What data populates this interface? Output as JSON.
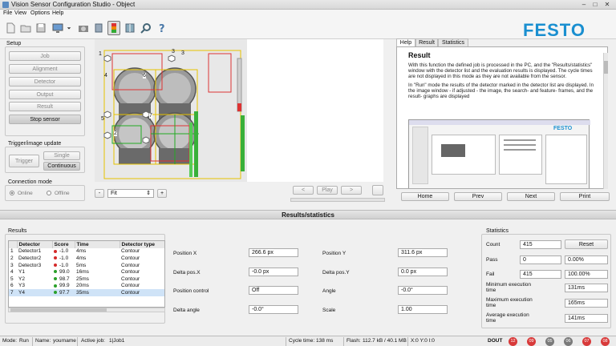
{
  "window": {
    "title": "Vision Sensor Configuration Studio - Object"
  },
  "menu": [
    "File",
    "View",
    "Options",
    "Help"
  ],
  "toolbar_icons": [
    "new-icon",
    "open-icon",
    "save-icon",
    "monitor-icon",
    "camera-icon",
    "film-icon",
    "sensor-icon",
    "run-icon",
    "layout-icon",
    "zoom-icon",
    "help-icon"
  ],
  "brand": "FESTO",
  "setup": {
    "title": "Setup",
    "buttons": [
      "Job",
      "Alignment",
      "Detector",
      "Output",
      "Result",
      "Stop sensor"
    ]
  },
  "trigger": {
    "title": "Trigger/image update",
    "trigger_label": "Trigger",
    "single_label": "Single",
    "continuous_label": "Continuous"
  },
  "connection": {
    "title": "Connection mode",
    "online": "Online",
    "offline": "Offline"
  },
  "viewer_controls": {
    "minus": "-",
    "plus": "+",
    "zoom": "Fit",
    "prev": "<",
    "play": "Play",
    "next": ">"
  },
  "image_labels": [
    "1",
    "3",
    "4",
    "2",
    "5",
    "6",
    "7",
    "3"
  ],
  "help": {
    "tabs": [
      "Help",
      "Result",
      "Statistics"
    ],
    "title": "Result",
    "p1": "With this function the defined job is processed in the PC, and the \"Results/statistics\" window with the detector list and the evaluation results is displayed. The cycle times are not displayed in this mode as they are not available from the sensor.",
    "p2": "In \"Run\" mode the results of the detector marked in the detector list are displayed. In the image window - if adjusted - the image, the search- and feature- frames, and the result- graphs are displayed",
    "thumb_brand": "FESTO",
    "nav": [
      "Home",
      "Prev",
      "Next",
      "Print"
    ]
  },
  "results_bar": "Results/statistics",
  "results": {
    "title": "Results",
    "headers": [
      "",
      "Detector",
      "Score",
      "Time",
      "Detector type"
    ],
    "rows": [
      {
        "n": "1",
        "name": "Detector1",
        "score": "-1.0",
        "time": "4ms",
        "type": "Contour",
        "color": "#d42a2a"
      },
      {
        "n": "2",
        "name": "Detector2",
        "score": "-1.0",
        "time": "4ms",
        "type": "Contour",
        "color": "#d42a2a"
      },
      {
        "n": "3",
        "name": "Detector3",
        "score": "-1.0",
        "time": "5ms",
        "type": "Contour",
        "color": "#d42a2a"
      },
      {
        "n": "4",
        "name": "Y1",
        "score": "99.0",
        "time": "16ms",
        "type": "Contour",
        "color": "#2aa02a"
      },
      {
        "n": "5",
        "name": "Y2",
        "score": "98.7",
        "time": "25ms",
        "type": "Contour",
        "color": "#2aa02a"
      },
      {
        "n": "6",
        "name": "Y3",
        "score": "99.9",
        "time": "20ms",
        "type": "Contour",
        "color": "#2aa02a"
      },
      {
        "n": "7",
        "name": "Y4",
        "score": "97.7",
        "time": "35ms",
        "type": "Contour",
        "color": "#2aa02a"
      }
    ]
  },
  "details": {
    "position_x_label": "Position X",
    "position_x": "266.6 px",
    "position_y_label": "Position Y",
    "position_y": "311.6 px",
    "delta_x_label": "Delta pos.X",
    "delta_x": "-0.0 px",
    "delta_y_label": "Delta pos.Y",
    "delta_y": "0.0 px",
    "pos_control_label": "Position control",
    "pos_control": "Off",
    "angle_label": "Angle",
    "angle": "-0.0°",
    "delta_angle_label": "Delta angle",
    "delta_angle": "-0.0°",
    "scale_label": "Scale",
    "scale": "1.00"
  },
  "statistics": {
    "title": "Statistics",
    "count_label": "Count",
    "count": "415",
    "reset": "Reset",
    "pass_label": "Pass",
    "pass": "0",
    "pass_pct": "0.00%",
    "fail_label": "Fail",
    "fail": "415",
    "fail_pct": "100.00%",
    "min_label": "Minimum execution time",
    "min": "131ms",
    "max_label": "Maximum execution time",
    "max": "165ms",
    "avg_label": "Average execution time",
    "avg": "141ms"
  },
  "status": {
    "mode_label": "Mode:",
    "mode": "Run",
    "name_label": "Name:",
    "name": "yourname",
    "job_label": "Active job:",
    "job": "1|Job1",
    "cycle_label": "Cycle time:",
    "cycle": "138 ms",
    "flash_label": "Flash:",
    "flash": "112.7 kB / 40.1 MB",
    "coords": "X:0 Y:0 I:0",
    "dout": "DOUT",
    "io": [
      {
        "label": "12",
        "color": "#d83a3a"
      },
      {
        "label": "09",
        "color": "#d83a3a"
      },
      {
        "label": "05",
        "color": "#7a7a7a"
      },
      {
        "label": "06",
        "color": "#7a7a7a"
      },
      {
        "label": "07",
        "color": "#d83a3a"
      },
      {
        "label": "08",
        "color": "#d83a3a"
      }
    ]
  }
}
